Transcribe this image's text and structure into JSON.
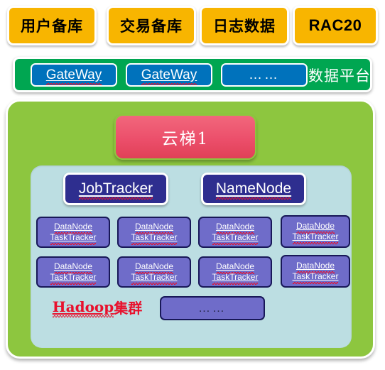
{
  "diagram": {
    "title": "Hadoop data platform architecture",
    "colors": {
      "source_box": "#F8B500",
      "platform_bar": "#00A651",
      "gateway_box": "#0072BC",
      "cluster_container": "#8DC63F",
      "yunti_box": "#EC4F6B",
      "hadoop_panel": "#BCDEE2",
      "master_node": "#2E2E8F",
      "data_node": "#6F6CC9",
      "data_node_border": "#181858",
      "caption_red": "#E8112D",
      "white": "#FFFFFF",
      "black": "#000000"
    }
  },
  "sources": {
    "items": [
      {
        "label": "用户备库",
        "script": "cjk"
      },
      {
        "label": "交易备库",
        "script": "cjk"
      },
      {
        "label": "日志数据",
        "script": "cjk"
      },
      {
        "label": "RAC20",
        "script": "latin"
      }
    ]
  },
  "platform": {
    "label": "数据平台",
    "gateways": [
      {
        "label": "GateWay",
        "type": "gateway"
      },
      {
        "label": "GateWay",
        "type": "gateway"
      },
      {
        "label": "……",
        "type": "ellipsis"
      }
    ]
  },
  "cluster": {
    "yunti_label": "云梯1",
    "masters": [
      {
        "label": "JobTracker"
      },
      {
        "label": "NameNode"
      }
    ],
    "slaves": [
      {
        "line1": "DataNode",
        "line2": "TaskTracker"
      },
      {
        "line1": "DataNode",
        "line2": "TaskTracker"
      },
      {
        "line1": "DataNode",
        "line2": "TaskTracker"
      },
      {
        "line1": "DataNode",
        "line2": "TaskTracker"
      },
      {
        "line1": "DataNode",
        "line2": "TaskTracker"
      },
      {
        "line1": "DataNode",
        "line2": "TaskTracker"
      },
      {
        "line1": "DataNode",
        "line2": "TaskTracker"
      },
      {
        "line1": "DataNode",
        "line2": "TaskTracker"
      }
    ],
    "caption_prefix": "Hadoop",
    "caption_suffix": "集群",
    "ellipsis_label": "……"
  }
}
